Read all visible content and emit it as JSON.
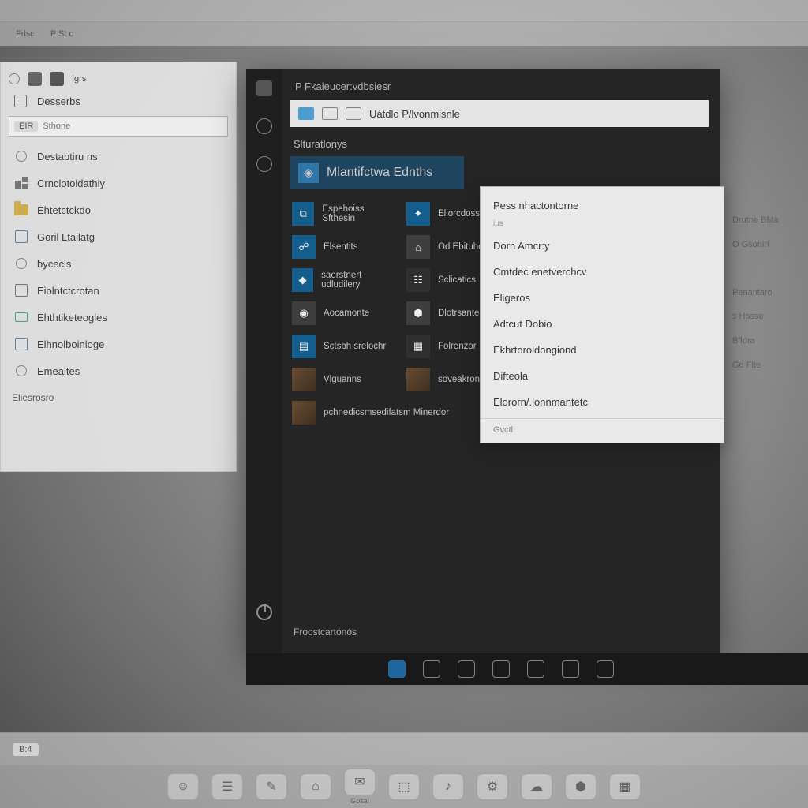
{
  "browser": {
    "tab1": "Frlsc",
    "tab2": "P St c"
  },
  "explorer": {
    "topbar_label": "Igrs",
    "head": "Desserbs",
    "filter_tag": "EIR",
    "filter_placeholder": "Sthone",
    "items": [
      "Destabtiru ns",
      "Crnclotoidathiy",
      "Ehtetctckdo",
      "Goril Ltailatg",
      "bycecis",
      "Eiolntctcrotan",
      "Ehthtiketeogles",
      "Elhnolboinloge",
      "Emealtes"
    ],
    "footer": "Eliesrosro"
  },
  "startmenu": {
    "title": "P  Fkaleucer:vdbsiesr",
    "address": "Uátdlo P/lvonmisnle",
    "section": "Slturatlonys",
    "highlight": "Mlantifctwa Ednths",
    "apps_left": [
      "Espehoiss Sfthesin",
      "Elsentits",
      "saerstnert udludilery",
      "Aocamonte",
      "Sctsbh srelochr",
      "Vlguanns"
    ],
    "apps_right": [
      "Eliorcdoss",
      "Od Ebituhon",
      "Sclicatics",
      "Dlotrsanter",
      "Folrenzor",
      "soveakron"
    ],
    "app_wide": "pchnedicsmsedifatsm Minerdor",
    "bottom": "Froostcartónós"
  },
  "context": {
    "head": "Pess nhactontorne",
    "sub": "ius",
    "items": [
      "Dorn Amcr:y",
      "Cmtdec enetverchcv",
      "Eligeros",
      "Adtcut Dobio",
      "Ekhrtoroldongiond",
      "Difteola",
      "Elororn/.lonnmantetc"
    ],
    "foot": "Gvctl"
  },
  "bg": {
    "l1": "Drutne BMa",
    "l2": "O Gsonih",
    "l3": "Penantaro",
    "l4": "s Hosse",
    "l5": "Bfldra",
    "l6": "Go Flte"
  },
  "tray": {
    "badge": "B:4"
  },
  "dock": {
    "items": [
      "",
      "",
      "",
      "",
      "Gosal",
      "",
      "",
      "",
      ""
    ]
  }
}
